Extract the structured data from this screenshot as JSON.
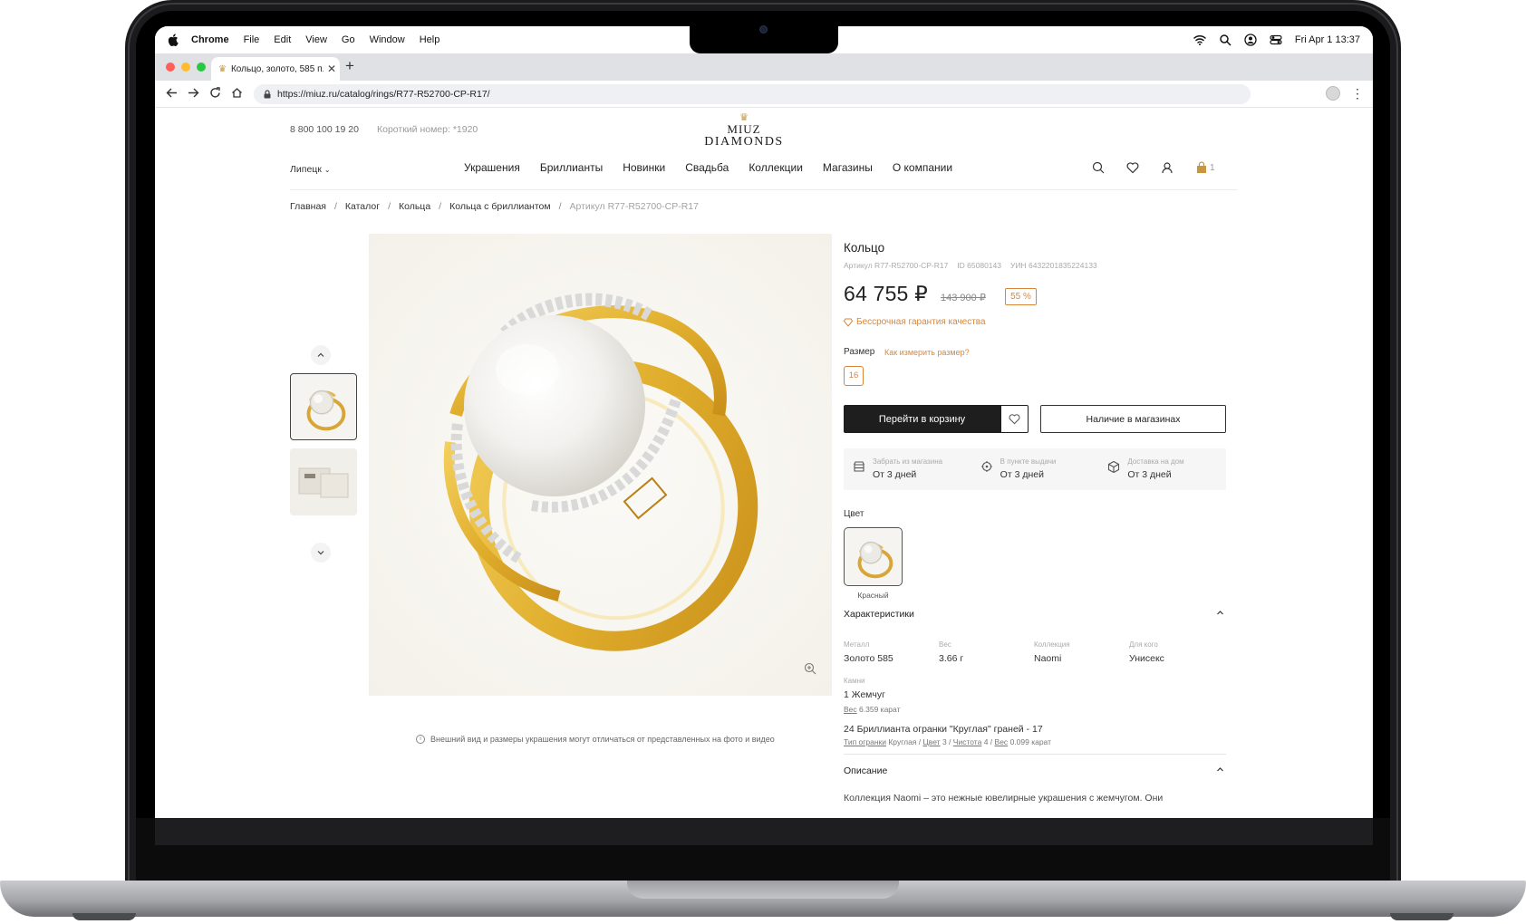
{
  "menubar": {
    "app": "Chrome",
    "menus": [
      "File",
      "Edit",
      "View",
      "Go",
      "Window",
      "Help"
    ],
    "clock": "Fri Apr 1  13:37"
  },
  "browser": {
    "tab_title": "Кольцо, золото, 585 п...",
    "url": "https://miuz.ru/catalog/rings/R77-R52700-CP-R17/"
  },
  "site": {
    "phone": "8 800 100 19 20",
    "short_number": "Короткий номер: *1920",
    "logo_line1": "MIUZ",
    "logo_line2": "DIAMONDS",
    "city": "Липецк",
    "nav": [
      "Украшения",
      "Бриллианты",
      "Новинки",
      "Свадьба",
      "Коллекции",
      "Магазины",
      "О компании"
    ],
    "cart_count": "1"
  },
  "breadcrumbs": {
    "items": [
      "Главная",
      "Каталог",
      "Кольца",
      "Кольца с бриллиантом"
    ],
    "current": "Артикул R77-R52700-CP-R17",
    "separator": "/"
  },
  "gallery": {
    "disclaimer": "Внешний вид и размеры украшения могут отличаться от представленных на фото и видео"
  },
  "product": {
    "title": "Кольцо",
    "article": "Артикул R77-R52700-CP-R17",
    "id": "ID 65080143",
    "uin": "УИН 6432201835224133",
    "price": "64 755 ₽",
    "old_price": "143 900 ₽",
    "discount": "55 %",
    "guarantee": "Бессрочная гарантия качества",
    "size_label": "Размер",
    "size_help": "Как измерить размер?",
    "size_value": "16",
    "cart_button": "Перейти в корзину",
    "stores_button": "Наличие в магазинах",
    "delivery": [
      {
        "label": "Забрать из магазина",
        "value": "От 3 дней",
        "icon": "store-icon"
      },
      {
        "label": "В пункте выдачи",
        "value": "От 3 дней",
        "icon": "pickup-point-icon"
      },
      {
        "label": "Доставка на дом",
        "value": "От 3 дней",
        "icon": "box-icon"
      }
    ],
    "color_label": "Цвет",
    "color_name": "Красный"
  },
  "characteristics": {
    "title": "Характеристики",
    "items": [
      {
        "label": "Металл",
        "value": "Золото 585"
      },
      {
        "label": "Вес",
        "value": "3.66 г"
      },
      {
        "label": "Коллекция",
        "value": "Naomi"
      },
      {
        "label": "Для кого",
        "value": "Унисекс"
      }
    ],
    "stones_label": "Камни",
    "pearl": "1 Жемчуг",
    "pearl_weight_label": "Вес",
    "pearl_weight": "6.359 карат",
    "diamonds": "24 Бриллианта огранки \"Круглая\" граней - 17",
    "cut_label": "Тип огранки",
    "cut_value": "Круглая",
    "color_label": "Цвет",
    "color_value": "3",
    "clarity_label": "Чистота",
    "clarity_value": "4",
    "weight_label": "Вес",
    "weight_value": "0.099 карат"
  },
  "description": {
    "title": "Описание",
    "text": "Коллекция Naomi – это нежные ювелирные украшения с жемчугом. Они"
  },
  "colors": {
    "accent": "#d9863b",
    "dark_button": "#1e1e1e",
    "gold": "#c8963e"
  }
}
